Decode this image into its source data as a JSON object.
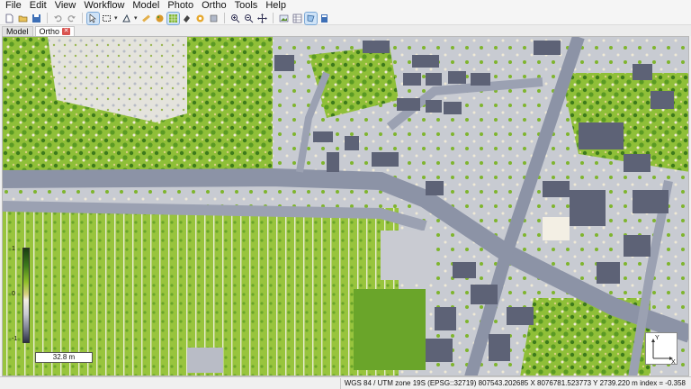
{
  "menu": [
    "File",
    "Edit",
    "View",
    "Workflow",
    "Model",
    "Photo",
    "Ortho",
    "Tools",
    "Help"
  ],
  "toolbar": {
    "icons": [
      "new-document-icon",
      "open-folder-icon",
      "save-icon",
      "undo-icon",
      "redo-icon",
      "pointer-icon",
      "rectangle-selection-icon",
      "navigation-icon",
      "ruler-icon",
      "paint-icon",
      "patch-icon",
      "grid-icon",
      "eraser-icon",
      "brush-icon",
      "zoom-in-icon",
      "zoom-out-icon",
      "move-icon",
      "rotate-icon",
      "image-icon",
      "table-icon",
      "shapes-icon",
      "calculator-icon"
    ]
  },
  "tabs": [
    {
      "label": "Model",
      "active": false
    },
    {
      "label": "Ortho",
      "active": true
    }
  ],
  "viewport": {
    "colorscale": {
      "top": "1",
      "middle": "0",
      "bottom": "-1"
    },
    "scalebar": "32.8 m",
    "gizmo": {
      "y_label": "Y",
      "x_label": "X"
    }
  },
  "status": {
    "text": "WGS 84 / UTM zone 19S (EPSG::32719)   807543.202685 X   8076781.523773 Y   2739.220 m   index = -0.358"
  },
  "colors": {
    "vegetation_dark": "#2f6b1a",
    "vegetation": "#7fb52e",
    "vegetation_light": "#b9d36a",
    "bare": "#efe9d6",
    "road": "#8c93a6",
    "building": "#5d6276"
  }
}
